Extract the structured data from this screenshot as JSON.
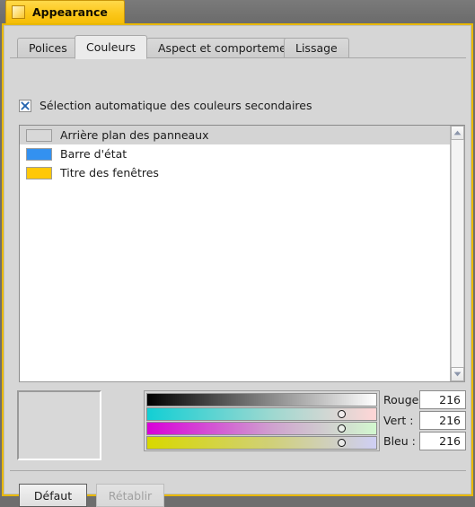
{
  "window": {
    "title": "Appearance",
    "icon": "window-square-icon",
    "accent_color": "#e8b800",
    "titlebar_color": "#6e6e6e"
  },
  "tabs": [
    {
      "label": "Polices",
      "active": false
    },
    {
      "label": "Couleurs",
      "active": true
    },
    {
      "label": "Aspect et comportement",
      "active": false
    },
    {
      "label": "Lissage",
      "active": false
    }
  ],
  "auto_select": {
    "label": "Sélection automatique des couleurs secondaires",
    "checked": true,
    "check_glyph": "x-mark-icon",
    "check_color": "#2565b0"
  },
  "color_list": {
    "items": [
      {
        "label": "Arrière plan des panneaux",
        "color": "#d8d8d8",
        "selected": true
      },
      {
        "label": "Barre d'état",
        "color": "#3391f0",
        "selected": false
      },
      {
        "label": "Titre des fenêtres",
        "color": "#ffc809",
        "selected": false
      }
    ],
    "selection_color": "#d4d4d4"
  },
  "scrollbar": {
    "up_icon": "chevron-up-icon",
    "down_icon": "chevron-down-icon"
  },
  "preview": {
    "color": "#d8d8d8"
  },
  "sliders": {
    "bars": [
      {
        "name": "value-bar",
        "from": "#000000",
        "to": "#ffffff",
        "handle": false,
        "position": 85
      },
      {
        "name": "red-bar",
        "from": "#12cfd4",
        "to": "#ffd6d6",
        "handle": true,
        "position": 85
      },
      {
        "name": "green-bar",
        "from": "#d800d8",
        "to": "#d2f8cf",
        "handle": true,
        "position": 85
      },
      {
        "name": "blue-bar",
        "from": "#d8d800",
        "to": "#cfcff5",
        "handle": true,
        "position": 85
      }
    ]
  },
  "rgb": [
    {
      "label": "Rouge :",
      "value": "216",
      "name": "red"
    },
    {
      "label": "Vert :",
      "value": "216",
      "name": "green"
    },
    {
      "label": "Bleu :",
      "value": "216",
      "name": "blue"
    }
  ],
  "footer": {
    "default_label": "Défaut",
    "reset_label": "Rétablir",
    "reset_enabled": false
  }
}
